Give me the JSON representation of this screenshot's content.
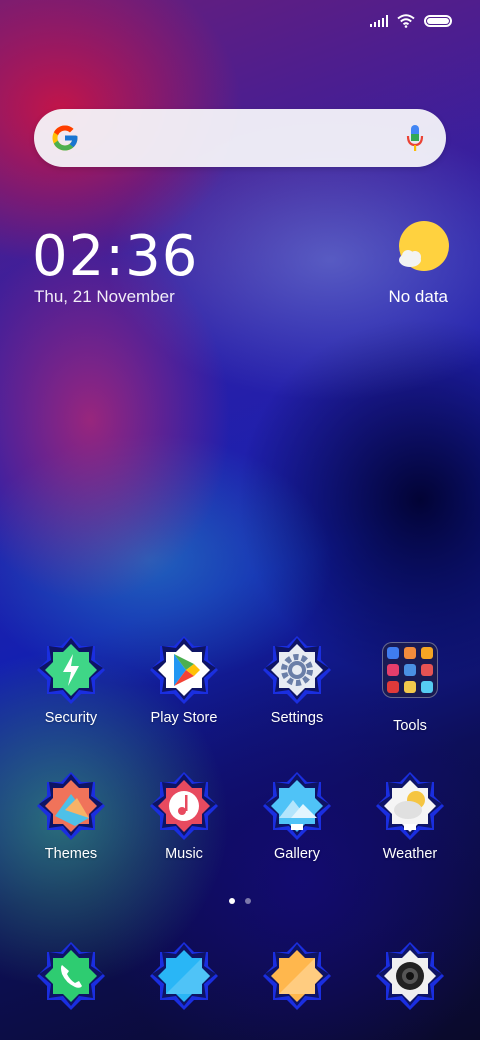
{
  "status_bar": {
    "signal_icon": "signal-icon",
    "wifi_icon": "wifi-icon",
    "battery_icon": "battery-icon"
  },
  "search_widget": {
    "logo": "google-g-icon",
    "mic": "mic-icon"
  },
  "clock_widget": {
    "time": "02:36",
    "date": "Thu, 21 November"
  },
  "weather_widget": {
    "icon": "sun-cloud-icon",
    "status": "No data"
  },
  "apps_row1": [
    {
      "label": "Security",
      "icon": "security-icon"
    },
    {
      "label": "Play Store",
      "icon": "play-store-icon"
    },
    {
      "label": "Settings",
      "icon": "settings-gear-icon"
    },
    {
      "label": "Tools",
      "icon": "folder-icon"
    }
  ],
  "apps_row2": [
    {
      "label": "Themes",
      "icon": "themes-icon"
    },
    {
      "label": "Music",
      "icon": "music-icon"
    },
    {
      "label": "Gallery",
      "icon": "gallery-icon"
    },
    {
      "label": "Weather",
      "icon": "weather-icon"
    }
  ],
  "dock": [
    {
      "icon": "phone-icon"
    },
    {
      "icon": "messages-icon"
    },
    {
      "icon": "notes-icon"
    },
    {
      "icon": "camera-icon"
    }
  ],
  "page_indicator": {
    "pages": 2,
    "current": 1
  },
  "colors": {
    "accent_green": "#2ecc71",
    "star_blue": "#1a2ee0"
  }
}
